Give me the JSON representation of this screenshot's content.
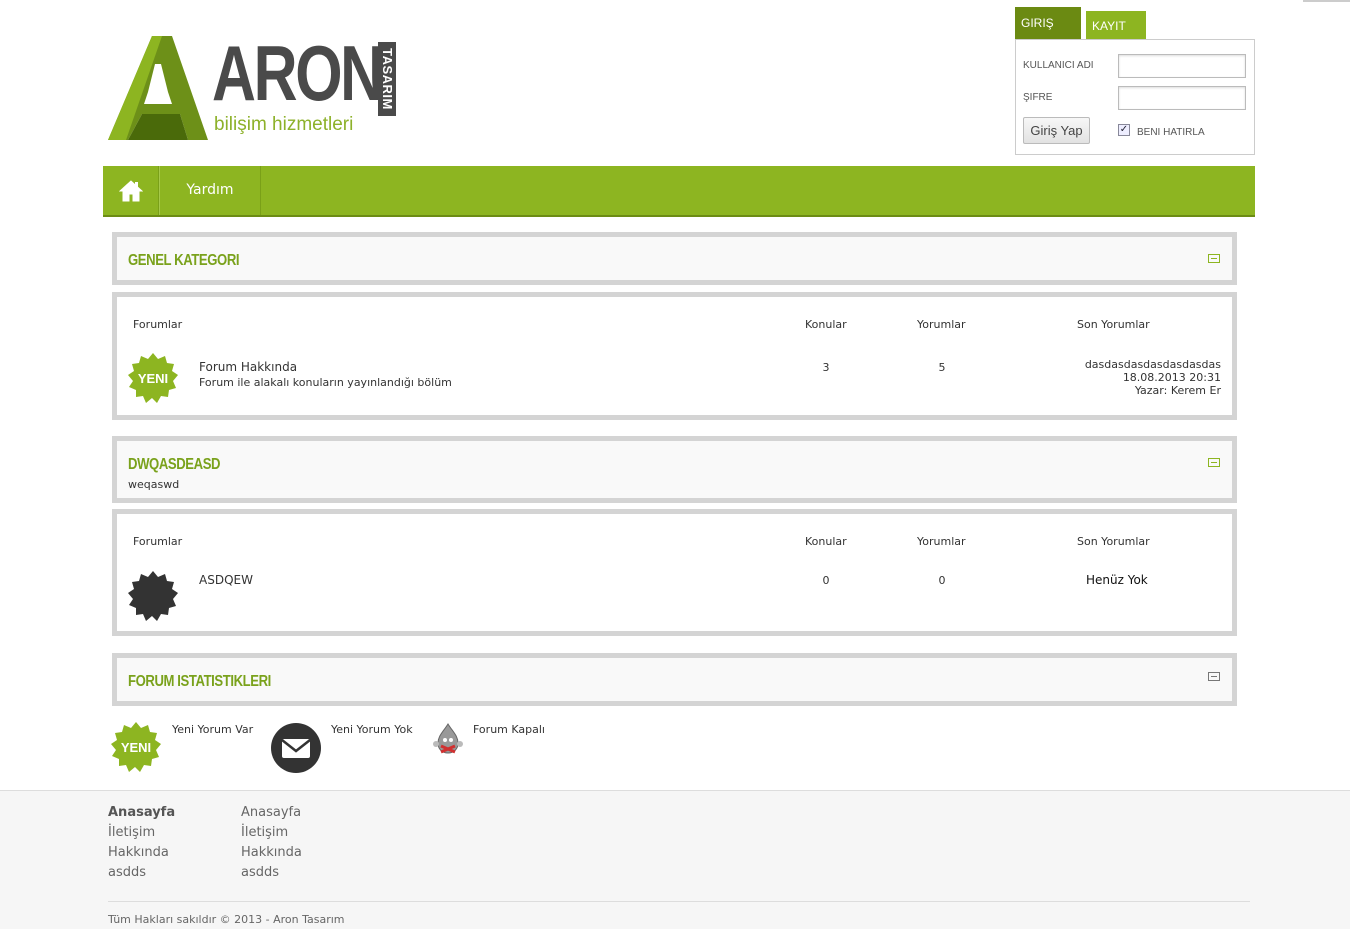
{
  "logo": {
    "word": "ARON",
    "side": "TASARIM",
    "tagline": "bilişim hizmetleri"
  },
  "login": {
    "tab_login": "GIRIŞ YAP",
    "tab_register": "KAYIT OL",
    "username_label": "KULLANICI ADI",
    "password_label": "ŞIFRE",
    "submit_label": "Giriş Yap",
    "remember_label": "BENI HATIRLA",
    "remember_checked": true
  },
  "nav": {
    "home_icon": "home-icon",
    "items": [
      "Yardım"
    ]
  },
  "categories": [
    {
      "title": "GENEL KATEGORI",
      "subtitle": "",
      "columns": {
        "forums": "Forumlar",
        "topics": "Konular",
        "replies": "Yorumlar",
        "last": "Son Yorumlar"
      },
      "forums": [
        {
          "status": "new",
          "badge_text": "YENI",
          "name": "Forum Hakkında",
          "description": "Forum ile alakalı konuların yayınlandığı bölüm",
          "topics": "3",
          "replies": "5",
          "last_title": "dasdasdasdasdasdasdas",
          "last_date": "18.08.2013 20:31",
          "last_author": "Yazar: Kerem Er"
        }
      ]
    },
    {
      "title": "DWQASDEASD",
      "subtitle": "weqaswd",
      "columns": {
        "forums": "Forumlar",
        "topics": "Konular",
        "replies": "Yorumlar",
        "last": "Son Yorumlar"
      },
      "forums": [
        {
          "status": "none",
          "name": "ASDQEW",
          "topics": "0",
          "replies": "0",
          "last_title": "Henüz Yok"
        }
      ]
    }
  ],
  "stats": {
    "title": "FORUM ISTATISTIKLERI"
  },
  "legend": [
    {
      "icon": "new-badge-icon",
      "badge_text": "YENI",
      "label": "Yeni Yorum Var"
    },
    {
      "icon": "mail-icon",
      "label": "Yeni Yorum Yok"
    },
    {
      "icon": "locked-forum-icon",
      "label": "Forum Kapalı"
    }
  ],
  "footer": {
    "col1": [
      "Anasayfa",
      "İletişim",
      "Hakkında",
      "asdds"
    ],
    "col2": [
      "Anasayfa",
      "İletişim",
      "Hakkında",
      "asdds"
    ],
    "copyright": "Tüm Hakları sakıldır © 2013 - Aron Tasarım"
  },
  "colors": {
    "accent": "#8db521",
    "accent_dark": "#6b8a12",
    "logo_grey": "#4a4a4a"
  }
}
